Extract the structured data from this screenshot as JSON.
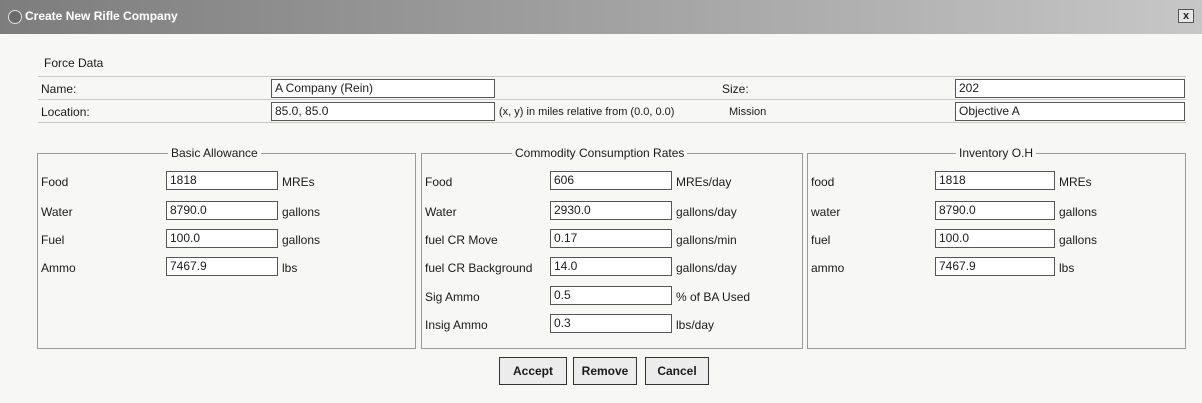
{
  "window": {
    "title": "Create New Rifle Company",
    "close_label": "x"
  },
  "force_data": {
    "section_label": "Force Data",
    "name_label": "Name:",
    "name_value": "A Company (Rein)",
    "size_label": "Size:",
    "size_value": "202",
    "location_label": "Location:",
    "location_value": "85.0, 85.0",
    "location_note": "(x, y) in miles relative from (0.0, 0.0)",
    "mission_label": "Mission",
    "mission_value": "Objective A"
  },
  "basic_allowance": {
    "title": "Basic Allowance",
    "rows": [
      {
        "label": "Food",
        "value": "1818",
        "unit": "MREs"
      },
      {
        "label": "Water",
        "value": "8790.0",
        "unit": "gallons"
      },
      {
        "label": "Fuel",
        "value": "100.0",
        "unit": "gallons"
      },
      {
        "label": "Ammo",
        "value": "7467.9",
        "unit": "lbs"
      }
    ]
  },
  "consumption": {
    "title": "Commodity Consumption Rates",
    "rows": [
      {
        "label": "Food",
        "value": "606",
        "unit": "MREs/day"
      },
      {
        "label": "Water",
        "value": "2930.0",
        "unit": "gallons/day"
      },
      {
        "label": "fuel CR Move",
        "value": "0.17",
        "unit": "gallons/min"
      },
      {
        "label": "fuel CR Background",
        "value": "14.0",
        "unit": "gallons/day"
      },
      {
        "label": "Sig Ammo",
        "value": "0.5",
        "unit": "% of BA Used"
      },
      {
        "label": "Insig Ammo",
        "value": "0.3",
        "unit": "lbs/day"
      }
    ]
  },
  "inventory": {
    "title": "Inventory O.H",
    "rows": [
      {
        "label": "food",
        "value": "1818",
        "unit": "MREs"
      },
      {
        "label": "water",
        "value": "8790.0",
        "unit": "gallons"
      },
      {
        "label": "fuel",
        "value": "100.0",
        "unit": "gallons"
      },
      {
        "label": "ammo",
        "value": "7467.9",
        "unit": "lbs"
      }
    ]
  },
  "buttons": {
    "accept": "Accept",
    "remove": "Remove",
    "cancel": "Cancel"
  }
}
